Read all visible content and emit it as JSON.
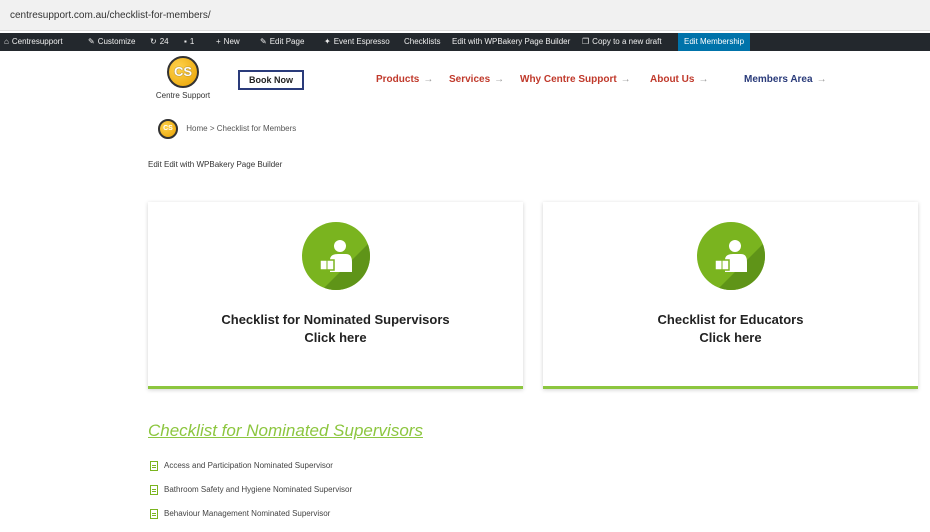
{
  "browser": {
    "url": "centresupport.com.au/checklist-for-members/"
  },
  "admin_bar": {
    "items": [
      {
        "label": "Centresupport",
        "icon": "home-icon"
      },
      {
        "label": "Customize",
        "icon": "brush-icon"
      },
      {
        "label": "24",
        "icon": "refresh-icon"
      },
      {
        "label": "1",
        "icon": "comment-icon"
      },
      {
        "label": "New",
        "icon": "plus-icon"
      },
      {
        "label": "Edit Page",
        "icon": "pencil-icon"
      },
      {
        "label": "Event Espresso",
        "icon": "ticket-icon"
      },
      {
        "label": "Checklists",
        "icon": ""
      },
      {
        "label": "Edit with WPBakery Page Builder",
        "icon": ""
      },
      {
        "label": "Copy to a new draft",
        "icon": "copy-icon"
      },
      {
        "label": "Edit Membership",
        "icon": ""
      }
    ]
  },
  "header": {
    "logo_initials": "CS",
    "logo_text": "Centre Support",
    "book_now": "Book Now",
    "nav": [
      {
        "label": "Products",
        "arrow": "→"
      },
      {
        "label": "Services",
        "arrow": "→"
      },
      {
        "label": "Why Centre Support",
        "arrow": "→"
      },
      {
        "label": "About Us",
        "arrow": "→"
      },
      {
        "label": "Members Area",
        "arrow": "→"
      }
    ]
  },
  "breadcrumb": {
    "logo_initials": "CS",
    "home": "Home",
    "sep": ">",
    "current": "Checklist for Members"
  },
  "edit_links": {
    "text": "Edit Edit with WPBakery Page Builder"
  },
  "cards": [
    {
      "title": "Checklist for Nominated Supervisors",
      "cta": "Click here"
    },
    {
      "title": "Checklist for Educators",
      "cta": "Click here"
    }
  ],
  "section": {
    "title": "Checklist for Nominated Supervisors",
    "items": [
      "Access and Participation Nominated Supervisor",
      "Bathroom Safety and Hygiene Nominated Supervisor",
      "Behaviour Management Nominated Supervisor"
    ]
  },
  "colors": {
    "accent_green": "#8cc63f",
    "nav_red": "#c0392b",
    "nav_navy": "#2a3b7a",
    "admin_bar": "#23282d",
    "admin_highlight": "#0073aa"
  }
}
